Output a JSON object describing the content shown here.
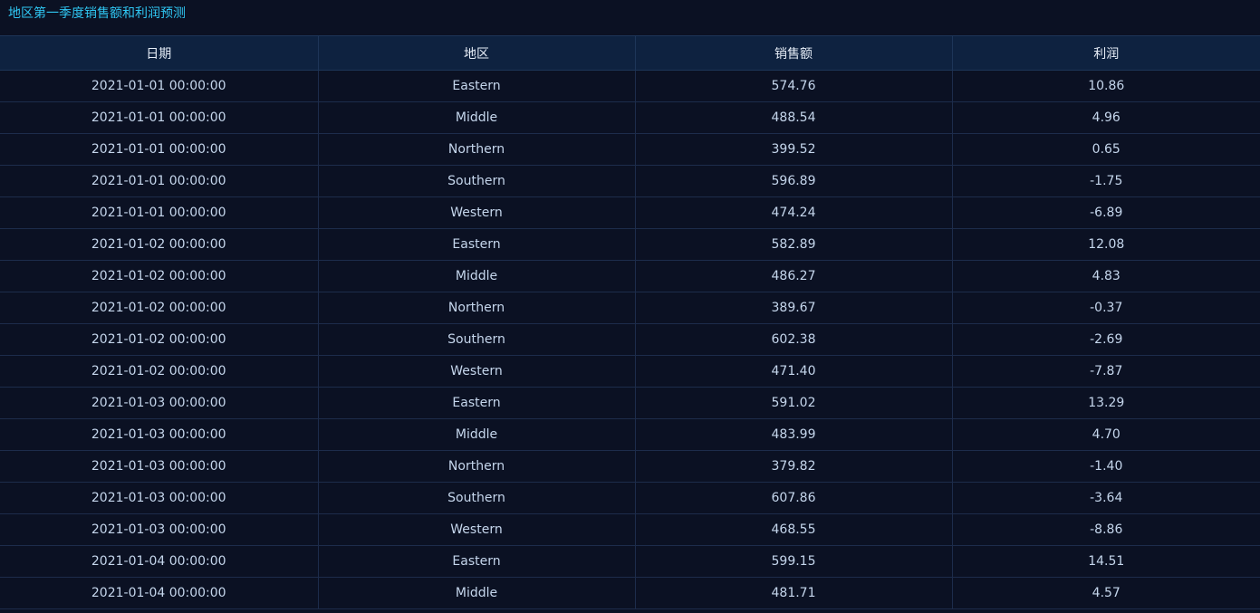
{
  "panel": {
    "title": "地区第一季度销售额和利润预测"
  },
  "table": {
    "columns": [
      "日期",
      "地区",
      "销售额",
      "利润"
    ],
    "rows": [
      [
        "2021-01-01 00:00:00",
        "Eastern",
        "574.76",
        "10.86"
      ],
      [
        "2021-01-01 00:00:00",
        "Middle",
        "488.54",
        "4.96"
      ],
      [
        "2021-01-01 00:00:00",
        "Northern",
        "399.52",
        "0.65"
      ],
      [
        "2021-01-01 00:00:00",
        "Southern",
        "596.89",
        "-1.75"
      ],
      [
        "2021-01-01 00:00:00",
        "Western",
        "474.24",
        "-6.89"
      ],
      [
        "2021-01-02 00:00:00",
        "Eastern",
        "582.89",
        "12.08"
      ],
      [
        "2021-01-02 00:00:00",
        "Middle",
        "486.27",
        "4.83"
      ],
      [
        "2021-01-02 00:00:00",
        "Northern",
        "389.67",
        "-0.37"
      ],
      [
        "2021-01-02 00:00:00",
        "Southern",
        "602.38",
        "-2.69"
      ],
      [
        "2021-01-02 00:00:00",
        "Western",
        "471.40",
        "-7.87"
      ],
      [
        "2021-01-03 00:00:00",
        "Eastern",
        "591.02",
        "13.29"
      ],
      [
        "2021-01-03 00:00:00",
        "Middle",
        "483.99",
        "4.70"
      ],
      [
        "2021-01-03 00:00:00",
        "Northern",
        "379.82",
        "-1.40"
      ],
      [
        "2021-01-03 00:00:00",
        "Southern",
        "607.86",
        "-3.64"
      ],
      [
        "2021-01-03 00:00:00",
        "Western",
        "468.55",
        "-8.86"
      ],
      [
        "2021-01-04 00:00:00",
        "Eastern",
        "599.15",
        "14.51"
      ],
      [
        "2021-01-04 00:00:00",
        "Middle",
        "481.71",
        "4.57"
      ]
    ]
  }
}
